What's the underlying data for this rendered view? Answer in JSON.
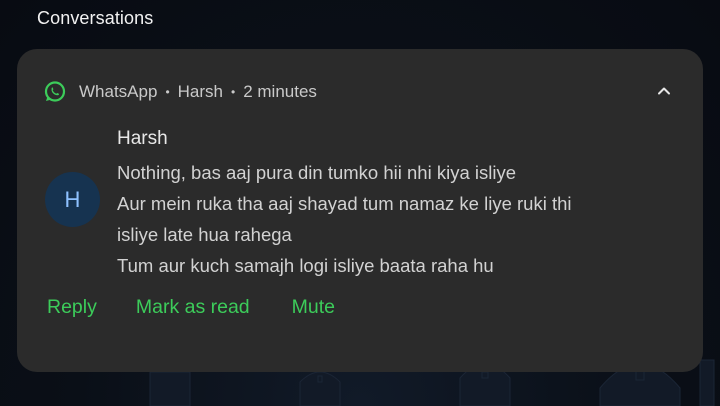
{
  "section": {
    "title": "Conversations"
  },
  "notification": {
    "app_icon": "whatsapp-icon",
    "app_name": "WhatsApp",
    "sender_header": "Harsh",
    "time": "2 minutes",
    "separator": "•",
    "expand_icon": "chevron-up-icon",
    "avatar_letter": "H",
    "sender_name": "Harsh",
    "messages": [
      "Nothing, bas aaj pura din tumko hii nhi kiya isliye",
      "Aur mein ruka tha aaj shayad tum namaz ke liye ruki thi",
      "isliye late hua rahega",
      "Tum aur kuch samajh logi isliye baata raha hu"
    ],
    "actions": {
      "reply": "Reply",
      "mark_read": "Mark as read",
      "mute": "Mute"
    }
  },
  "colors": {
    "card_bg": "#2b2b2b",
    "accent_green": "#3ccc5a",
    "avatar_bg": "#163350",
    "avatar_text": "#8fc2ff"
  }
}
